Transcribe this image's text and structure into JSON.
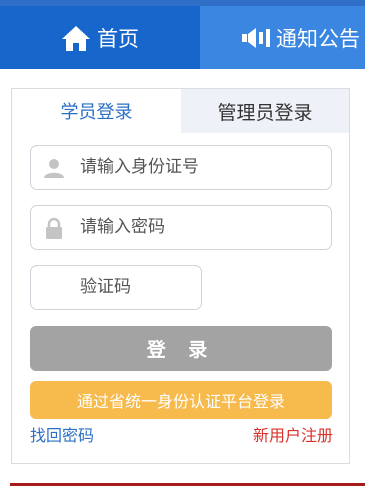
{
  "nav": {
    "home_label": "首页",
    "notice_label": "通知公告"
  },
  "login": {
    "tabs": {
      "student": "学员登录",
      "admin": "管理员登录"
    },
    "id_placeholder": "请输入身份证号",
    "password_placeholder": "请输入密码",
    "captcha_placeholder": "验证码",
    "login_button": "登 录",
    "province_button": "通过省统一身份认证平台登录",
    "forgot_link": "找回密码",
    "register_link": "新用户注册"
  },
  "colors": {
    "nav_active": "#1766cc",
    "nav_bg": "#3a86e0",
    "login_button": "#a3a3a3",
    "province_button": "#f7ba4d",
    "link_blue": "#2a6fc4",
    "link_red": "#d9322b"
  }
}
